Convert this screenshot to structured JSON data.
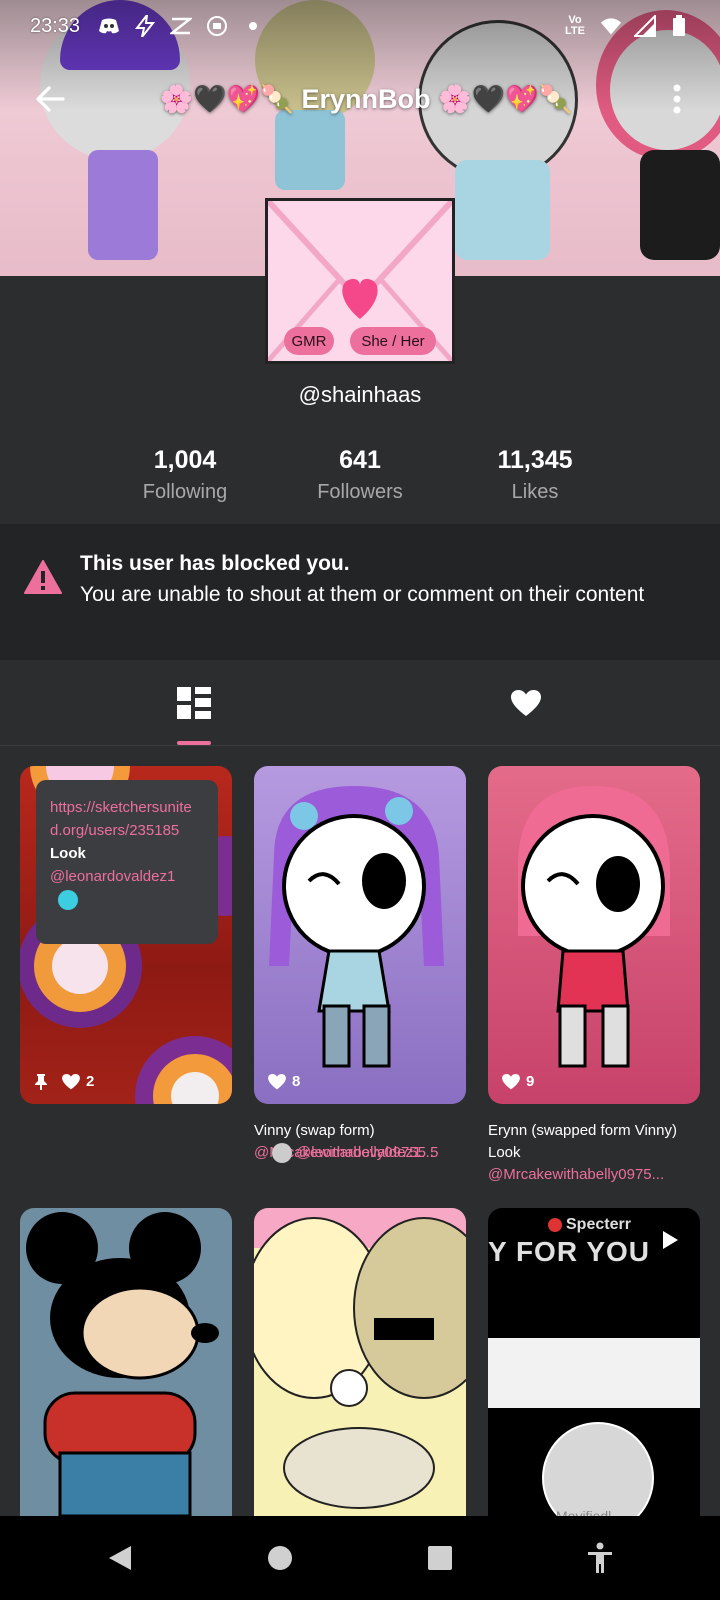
{
  "status_bar": {
    "time": "23:33",
    "network_label": "Vo LTE"
  },
  "header": {
    "title": "🌸🖤💖🍡 ErynnBob 🌸🖤💖🍡"
  },
  "profile": {
    "username": "@shainhaas",
    "tags": [
      "GMR",
      "She / Her"
    ],
    "stats": [
      {
        "value": "1,004",
        "label": "Following"
      },
      {
        "value": "641",
        "label": "Followers"
      },
      {
        "value": "11,345",
        "label": "Likes"
      }
    ]
  },
  "notice": {
    "title": "This user has blocked you.",
    "message": "You are unable to shout at them or comment on their content"
  },
  "posts": [
    {
      "likes": "2",
      "pinned": true,
      "tooltip": {
        "link": "https://sketchersunited.org/users/235185",
        "text": "Look",
        "mention": "@leonardovaldez1"
      }
    },
    {
      "likes": "8",
      "caption_title": "Vinny (swap form)",
      "caption_mention": "@Mrcakewithabelly09755 5",
      "caption_mention2": "@leonardovaldez1..."
    },
    {
      "likes": "9",
      "caption_title": "Erynn (swapped form Vinny) Look",
      "caption_mention": "@Mrcakewithabelly0975..."
    },
    {
      "likes": ""
    },
    {
      "likes": ""
    },
    {
      "overlay_text": "Specterr",
      "overlay_text2": "Y FOR YOU",
      "overlay_text3": "Movifiedl"
    }
  ],
  "colors": {
    "accent": "#ec6f9c",
    "background": "#2c2d2f",
    "notice_bg": "#232426"
  }
}
